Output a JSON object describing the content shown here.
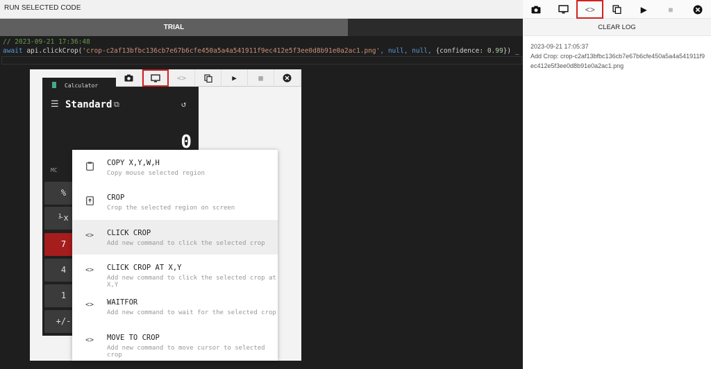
{
  "topbar": {
    "title": "RUN SELECTED CODE"
  },
  "tabs": {
    "active": "TRIAL"
  },
  "editor": {
    "comment": "// 2023-09-21 17:36:48",
    "await_kw": "await",
    "call": " api.clickCrop(",
    "crop_str": "'crop-c2af13bfbc136cb7e67b6cfe450a5a4a541911f9ec412e5f3ee0d8b91e0a2ac1.png'",
    "null1": ", null, null, ",
    "obj_open": "{confidence: ",
    "conf": "0.99",
    "obj_close": "}) _"
  },
  "calculator": {
    "title": "Calculator",
    "mode": "Standard",
    "display": "0",
    "mc": "MC",
    "keys": [
      "%",
      "⅟x",
      "7",
      "4",
      "1",
      "+/-"
    ]
  },
  "mini_toolbar": {
    "icons": [
      "camera-icon",
      "screen-icon",
      "code-icon",
      "copy-icon",
      "play-icon",
      "stop-icon",
      "close-icon"
    ]
  },
  "context_menu": {
    "items": [
      {
        "label": "COPY X,Y,W,H",
        "sub": "Copy mouse selected region",
        "icon": "clipboard-icon"
      },
      {
        "label": "CROP",
        "sub": "Crop the selected region on screen",
        "icon": "crop-icon"
      },
      {
        "label": "CLICK CROP",
        "sub": "Add new command to click the selected crop",
        "icon": "code-icon"
      },
      {
        "label": "CLICK CROP AT X,Y",
        "sub": "Add new command to click the selected crop at X,Y",
        "icon": "code-icon"
      },
      {
        "label": "WAITFOR",
        "sub": "Add new command to wait for the selected crop",
        "icon": "code-icon"
      },
      {
        "label": "MOVE TO CROP",
        "sub": "Add new command to move cursor to selected crop",
        "icon": "code-icon"
      }
    ]
  },
  "right_panel": {
    "clear_log": "CLEAR LOG",
    "log_time": "2023-09-21 17:05:37",
    "log_text": "Add Crop: crop-c2af13bfbc136cb7e67b6cfe450a5a4a541911f9ec412e5f3ee0d8b91e0a2ac1.png"
  },
  "colors": {
    "accent_red": "#d32020",
    "editor_bg": "#1e1e1e",
    "tab_active": "#5f5f5f"
  }
}
